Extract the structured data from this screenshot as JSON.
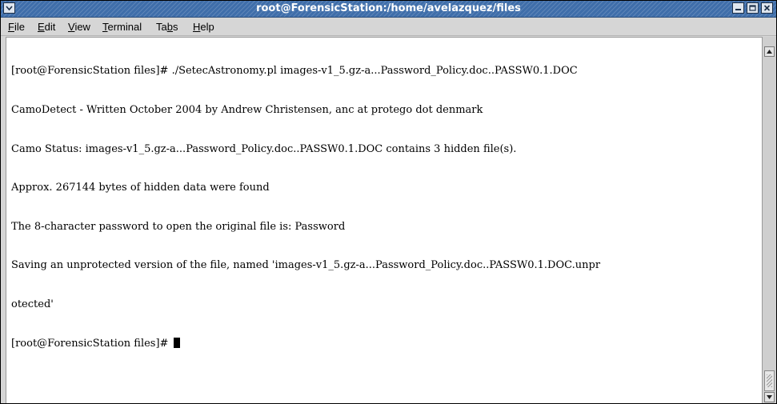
{
  "window": {
    "title": "root@ForensicStation:/home/avelazquez/files",
    "controls": {
      "menu_icon": "chevron-down-icon",
      "minimize_icon": "minimize-icon",
      "maximize_icon": "maximize-icon",
      "close_icon": "close-icon"
    }
  },
  "menubar": {
    "items": [
      {
        "label": "File",
        "mnemonic": "F",
        "rest": "ile"
      },
      {
        "label": "Edit",
        "mnemonic": "E",
        "rest": "dit"
      },
      {
        "label": "View",
        "mnemonic": "V",
        "rest": "iew"
      },
      {
        "label": "Terminal",
        "mnemonic": "T",
        "rest": "erminal"
      },
      {
        "label": "Tabs",
        "pre": "Ta",
        "mnemonic": "b",
        "rest": "s"
      },
      {
        "label": "Help",
        "mnemonic": "H",
        "rest": "elp"
      }
    ]
  },
  "terminal": {
    "lines": [
      "[root@ForensicStation files]# ./SetecAstronomy.pl images-v1_5.gz-a...Password_Policy.doc..PASSW0.1.DOC",
      "CamoDetect - Written October 2004 by Andrew Christensen, anc at protego dot denmark",
      "Camo Status: images-v1_5.gz-a...Password_Policy.doc..PASSW0.1.DOC contains 3 hidden file(s).",
      "Approx. 267144 bytes of hidden data were found",
      "The 8-character password to open the original file is: Password",
      "Saving an unprotected version of the file, named 'images-v1_5.gz-a...Password_Policy.doc..PASSW0.1.DOC.unpr",
      "otected'",
      "[root@ForensicStation files]# "
    ]
  },
  "scrollbar": {
    "up_icon": "scroll-up-arrow-icon",
    "down_icon": "scroll-down-arrow-icon"
  }
}
